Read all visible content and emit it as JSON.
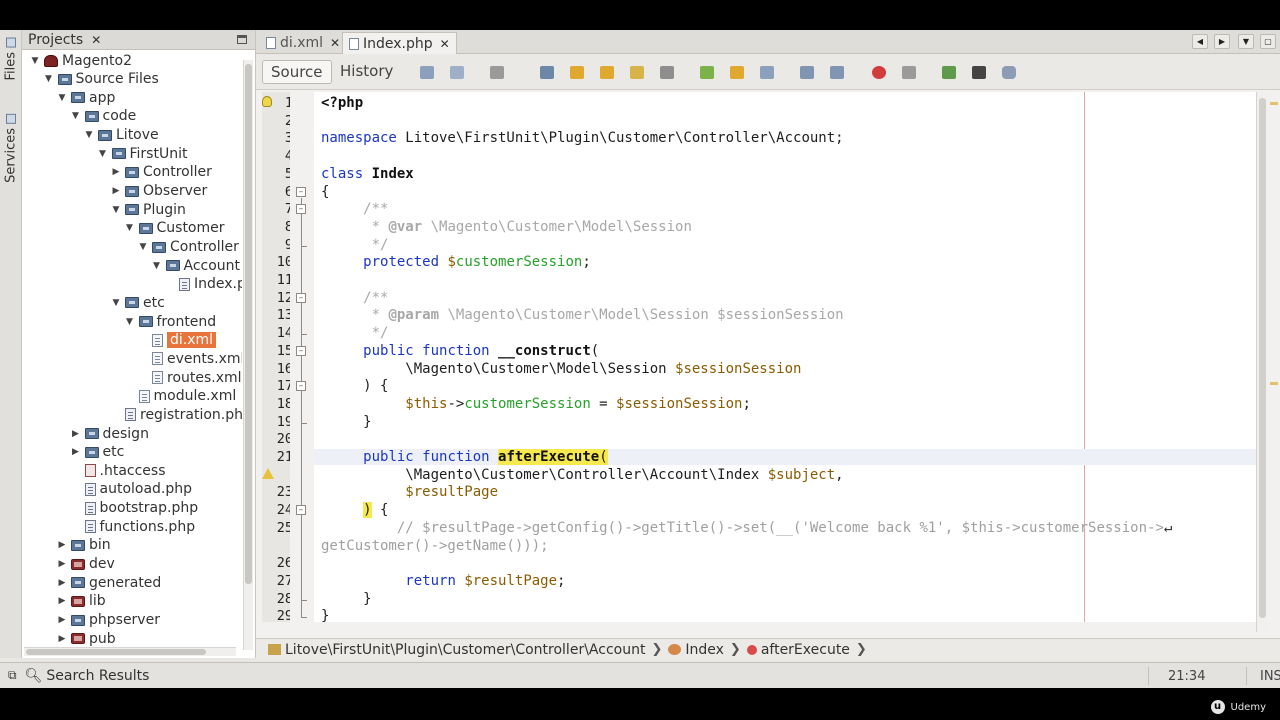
{
  "projects_panel": {
    "title": "Projects",
    "side_tabs": [
      "Files",
      "Services"
    ],
    "tree": [
      {
        "label": "Magento2",
        "depth": 0,
        "icon": "project",
        "toggle": "open"
      },
      {
        "label": "Source Files",
        "depth": 1,
        "icon": "folder",
        "toggle": "open"
      },
      {
        "label": "app",
        "depth": 2,
        "icon": "folder",
        "toggle": "open"
      },
      {
        "label": "code",
        "depth": 3,
        "icon": "folder",
        "toggle": "open"
      },
      {
        "label": "Litove",
        "depth": 4,
        "icon": "folder",
        "toggle": "open"
      },
      {
        "label": "FirstUnit",
        "depth": 5,
        "icon": "folder",
        "toggle": "open"
      },
      {
        "label": "Controller",
        "depth": 6,
        "icon": "folder",
        "toggle": "closed"
      },
      {
        "label": "Observer",
        "depth": 6,
        "icon": "folder",
        "toggle": "closed"
      },
      {
        "label": "Plugin",
        "depth": 6,
        "icon": "folder",
        "toggle": "open"
      },
      {
        "label": "Customer",
        "depth": 7,
        "icon": "folder",
        "toggle": "open"
      },
      {
        "label": "Controller",
        "depth": 8,
        "icon": "folder",
        "toggle": "open"
      },
      {
        "label": "Account",
        "depth": 9,
        "icon": "folder",
        "toggle": "open"
      },
      {
        "label": "Index.p",
        "depth": 10,
        "icon": "php",
        "toggle": ""
      },
      {
        "label": "etc",
        "depth": 6,
        "icon": "folder",
        "toggle": "open"
      },
      {
        "label": "frontend",
        "depth": 7,
        "icon": "folder",
        "toggle": "open"
      },
      {
        "label": "di.xml",
        "depth": 8,
        "icon": "file",
        "toggle": "",
        "selected": true
      },
      {
        "label": "events.xml",
        "depth": 8,
        "icon": "file",
        "toggle": ""
      },
      {
        "label": "routes.xml",
        "depth": 8,
        "icon": "file",
        "toggle": ""
      },
      {
        "label": "module.xml",
        "depth": 7,
        "icon": "file",
        "toggle": ""
      },
      {
        "label": "registration.ph",
        "depth": 6,
        "icon": "php",
        "toggle": ""
      },
      {
        "label": "design",
        "depth": 3,
        "icon": "folder",
        "toggle": "closed"
      },
      {
        "label": "etc",
        "depth": 3,
        "icon": "folder",
        "toggle": "closed"
      },
      {
        "label": ".htaccess",
        "depth": 3,
        "icon": "htaccess",
        "toggle": ""
      },
      {
        "label": "autoload.php",
        "depth": 3,
        "icon": "php",
        "toggle": ""
      },
      {
        "label": "bootstrap.php",
        "depth": 3,
        "icon": "php",
        "toggle": ""
      },
      {
        "label": "functions.php",
        "depth": 3,
        "icon": "php",
        "toggle": ""
      },
      {
        "label": "bin",
        "depth": 2,
        "icon": "folder",
        "toggle": "closed"
      },
      {
        "label": "dev",
        "depth": 2,
        "icon": "lib",
        "toggle": "closed"
      },
      {
        "label": "generated",
        "depth": 2,
        "icon": "folder",
        "toggle": "closed"
      },
      {
        "label": "lib",
        "depth": 2,
        "icon": "lib",
        "toggle": "closed"
      },
      {
        "label": "phpserver",
        "depth": 2,
        "icon": "folder",
        "toggle": "closed"
      },
      {
        "label": "pub",
        "depth": 2,
        "icon": "lib",
        "toggle": "closed"
      }
    ]
  },
  "editor": {
    "tabs": [
      {
        "label": "di.xml",
        "active": false
      },
      {
        "label": "Index.php",
        "active": true
      }
    ],
    "view_tabs": [
      {
        "label": "Source",
        "active": true
      },
      {
        "label": "History",
        "active": false
      }
    ],
    "code_lines": [
      {
        "n": "1",
        "html": "<span class='bold'>&lt;?php</span>"
      },
      {
        "n": "2",
        "html": ""
      },
      {
        "n": "3",
        "html": "<span class='kw'>namespace</span> Litove\\FirstUnit\\Plugin\\Customer\\Controller\\Account;"
      },
      {
        "n": "4",
        "html": ""
      },
      {
        "n": "5",
        "html": "<span class='kw'>class</span> <span class='bold'>Index</span>"
      },
      {
        "n": "6",
        "html": "{"
      },
      {
        "n": "7",
        "html": "     <span class='doc'>/**</span>"
      },
      {
        "n": "8",
        "html": "     <span class='doc'> * <b>@var</b> \\Magento\\Customer\\Model\\Session</span>"
      },
      {
        "n": "9",
        "html": "     <span class='doc'> */</span>"
      },
      {
        "n": "10",
        "html": "     <span class='kw'>protected</span> <span class='var'>$</span><span class='fld'>customerSession</span>;"
      },
      {
        "n": "11",
        "html": ""
      },
      {
        "n": "12",
        "html": "     <span class='doc'>/**</span>"
      },
      {
        "n": "13",
        "html": "     <span class='doc'> * <b>@param</b> \\Magento\\Customer\\Model\\Session $sessionSession</span>"
      },
      {
        "n": "14",
        "html": "     <span class='doc'> */</span>"
      },
      {
        "n": "15",
        "html": "     <span class='kw'>public function</span> <span class='bold'>__construct</span>("
      },
      {
        "n": "16",
        "html": "          \\Magento\\Customer\\Model\\Session <span class='var'>$sessionSession</span>"
      },
      {
        "n": "17",
        "html": "     ) {"
      },
      {
        "n": "18",
        "html": "          <span class='var'>$this</span>-&gt;<span class='fld'>customerSession</span> = <span class='var'>$sessionSession</span>;"
      },
      {
        "n": "19",
        "html": "     }"
      },
      {
        "n": "20",
        "html": ""
      },
      {
        "n": "21",
        "html": "     <span class='kw'>public function</span> <span class='bold hl'>afterExecute</span><span class='hl'>(</span>",
        "current": true
      },
      {
        "n": "",
        "html": "          \\Magento\\Customer\\Controller\\Account\\Index <span class='var'>$subject</span>,"
      },
      {
        "n": "23",
        "html": "          <span class='var'>$resultPage</span>"
      },
      {
        "n": "24",
        "html": "     <span class='hl'>)</span> {"
      },
      {
        "n": "25",
        "html": "         <span class='cmt'>// $resultPage-&gt;getConfig()-&gt;getTitle()-&gt;set(__('Welcome back %1', $this-&gt;customerSession-&gt;</span>↵"
      },
      {
        "n": "",
        "html": "<span class='cmt'>getCustomer()-&gt;getName()));</span>"
      },
      {
        "n": "26",
        "html": ""
      },
      {
        "n": "27",
        "html": "          <span class='kw'>return</span> <span class='var'>$resultPage</span>;"
      },
      {
        "n": "28",
        "html": "     }"
      },
      {
        "n": "29",
        "html": "}"
      }
    ],
    "breadcrumb": [
      "Litove\\FirstUnit\\Plugin\\Customer\\Controller\\Account",
      "Index",
      "afterExecute"
    ]
  },
  "status": {
    "search_results": "Search Results",
    "caret": "21:34",
    "mode": "INS"
  },
  "watermark": "Udemy"
}
